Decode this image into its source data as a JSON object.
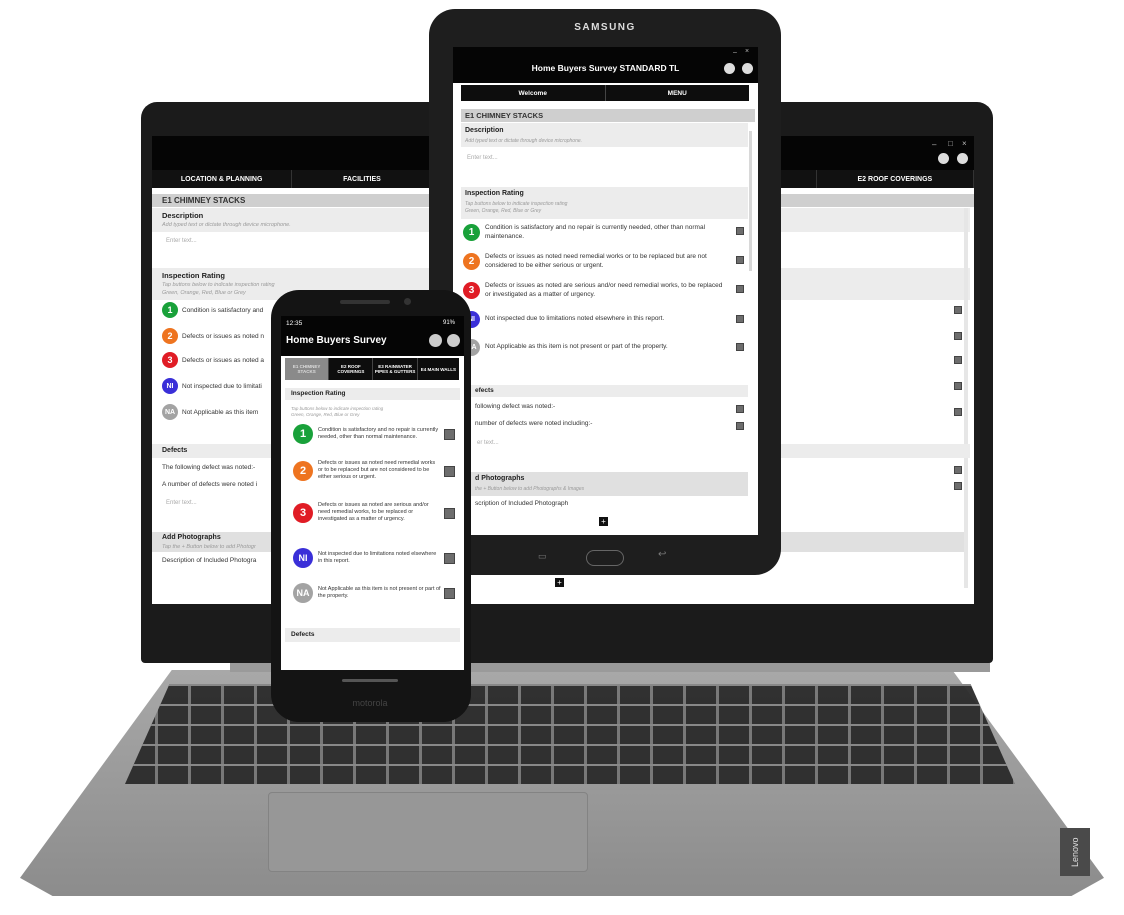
{
  "laptop": {
    "tabs": [
      "LOCATION & PLANNING",
      "FACILITIES",
      "",
      "",
      "",
      "E2 ROOF COVERINGS"
    ],
    "section_title": "E1  CHIMNEY STACKS",
    "description_label": "Description",
    "description_hint": "Add typed text or dictate through device microphone.",
    "enter_text": "Enter text...",
    "inspection_label": "Inspection Rating",
    "inspection_hint1": "Tap buttons below to indicate inspection rating",
    "inspection_hint2": "Green, Orange, Red, Blue or Grey",
    "ratings": [
      {
        "badge": "1",
        "text": "Condition is satisfactory and",
        "color": "#19a13a"
      },
      {
        "badge": "2",
        "text": "Defects or issues as noted n",
        "color": "#ee7420"
      },
      {
        "badge": "3",
        "text": "Defects or issues as noted a",
        "color": "#e01c25"
      },
      {
        "badge": "NI",
        "text": "Not inspected due to limitati",
        "color": "#3a2fd8"
      },
      {
        "badge": "NA",
        "text": "Not Applicable as this item",
        "color": "#a3a3a3"
      }
    ],
    "defects_label": "Defects",
    "defect_1": "The following defect was noted:-",
    "defect_2": "A number of defects were noted i",
    "photos_label": "Add Photographs",
    "photos_hint": "Tap the + Button below to add Photogr",
    "photos_desc": "Description of Included Photogra",
    "brand": "Lenovo"
  },
  "tablet": {
    "brand": "SAMSUNG",
    "title": "Home Buyers Survey STANDARD TL",
    "tab_welcome": "Welcome",
    "tab_menu": "MENU",
    "section_title": "E1  CHIMNEY STACKS",
    "description_label": "Description",
    "description_hint": "Add typed text or dictate through device microphone.",
    "enter_text": "Enter text...",
    "inspection_label": "Inspection Rating",
    "inspection_hint1": "Tap buttons below to indicate inspection rating",
    "inspection_hint2": "Green, Orange, Red, Blue or Grey",
    "ratings": [
      {
        "badge": "1",
        "text": "Condition is satisfactory and no repair is currently needed, other than normal maintenance."
      },
      {
        "badge": "2",
        "text": "Defects or issues as noted need remedial works or to be replaced but are not considered to be either serious or urgent."
      },
      {
        "badge": "3",
        "text": "Defects or issues as noted are serious and/or need remedial works, to be replaced or investigated as a matter of urgency."
      },
      {
        "badge": "NI",
        "text": "Not inspected due to limitations noted elsewhere in this report."
      },
      {
        "badge": "NA",
        "text": "Not Applicable as this item is not present or part of the property."
      }
    ],
    "defects_label": "efects",
    "defect_1": "following defect was noted:-",
    "defect_2": "number of defects were noted including:-",
    "enter_text_2": "er text...",
    "photos_label": "d Photographs",
    "photos_hint": "the + Button below to add Photographs & Images",
    "photos_desc": "scription of Included Photograph",
    "plus": "+"
  },
  "phone": {
    "status_time": "12:35",
    "status_battery": "91%",
    "title": "Home Buyers Survey",
    "tabs": [
      "E1 CHIMNEY STACKS",
      "E2 ROOF COVERINGS",
      "E3 RAINWATER PIPES & GUTTERS",
      "E4 MAIN WALLS"
    ],
    "inspection_label": "Inspection Rating",
    "inspection_hint1": "Tap buttons below to indicate inspection rating",
    "inspection_hint2": "Green, Orange, Red, Blue or Grey",
    "ratings": [
      {
        "badge": "1",
        "text": "Condition is satisfactory and no repair is currently needed, other than normal maintenance."
      },
      {
        "badge": "2",
        "text": "Defects or issues as noted need remedial works or to be replaced but are not considered to be either serious or urgent."
      },
      {
        "badge": "3",
        "text": "Defects or issues as noted are serious and/or need remedial works, to be replaced or investigated as a matter of urgency."
      },
      {
        "badge": "NI",
        "text": "Not inspected due to limitations noted elsewhere in this report."
      },
      {
        "badge": "NA",
        "text": "Not Applicable as this item is not present or part of the property."
      }
    ],
    "defects_label": "Defects",
    "brand": "motorola"
  }
}
